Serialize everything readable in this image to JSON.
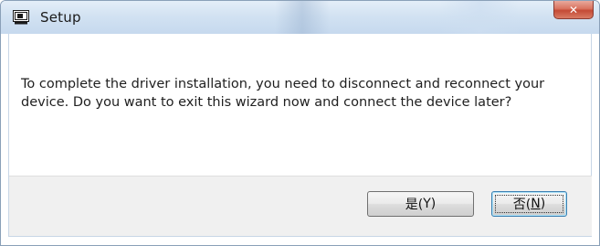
{
  "window": {
    "title": "Setup",
    "close_glyph": "✕"
  },
  "message": {
    "text": "To complete the driver installation, you need to disconnect and reconnect your device. Do you want to exit this wizard now and connect the device later?"
  },
  "buttons": {
    "yes": {
      "label_prefix": "是(",
      "mnemonic": "Y",
      "label_suffix": ")"
    },
    "no": {
      "label_prefix": "否(",
      "mnemonic": "N",
      "label_suffix": ")"
    }
  },
  "icons": {
    "app": "setup-app-icon",
    "close": "close-icon"
  },
  "colors": {
    "titlebar": "#d2e2f2",
    "close_button": "#c44a35",
    "footer": "#f0f0f0",
    "default_button_border": "#3c7fb1"
  }
}
